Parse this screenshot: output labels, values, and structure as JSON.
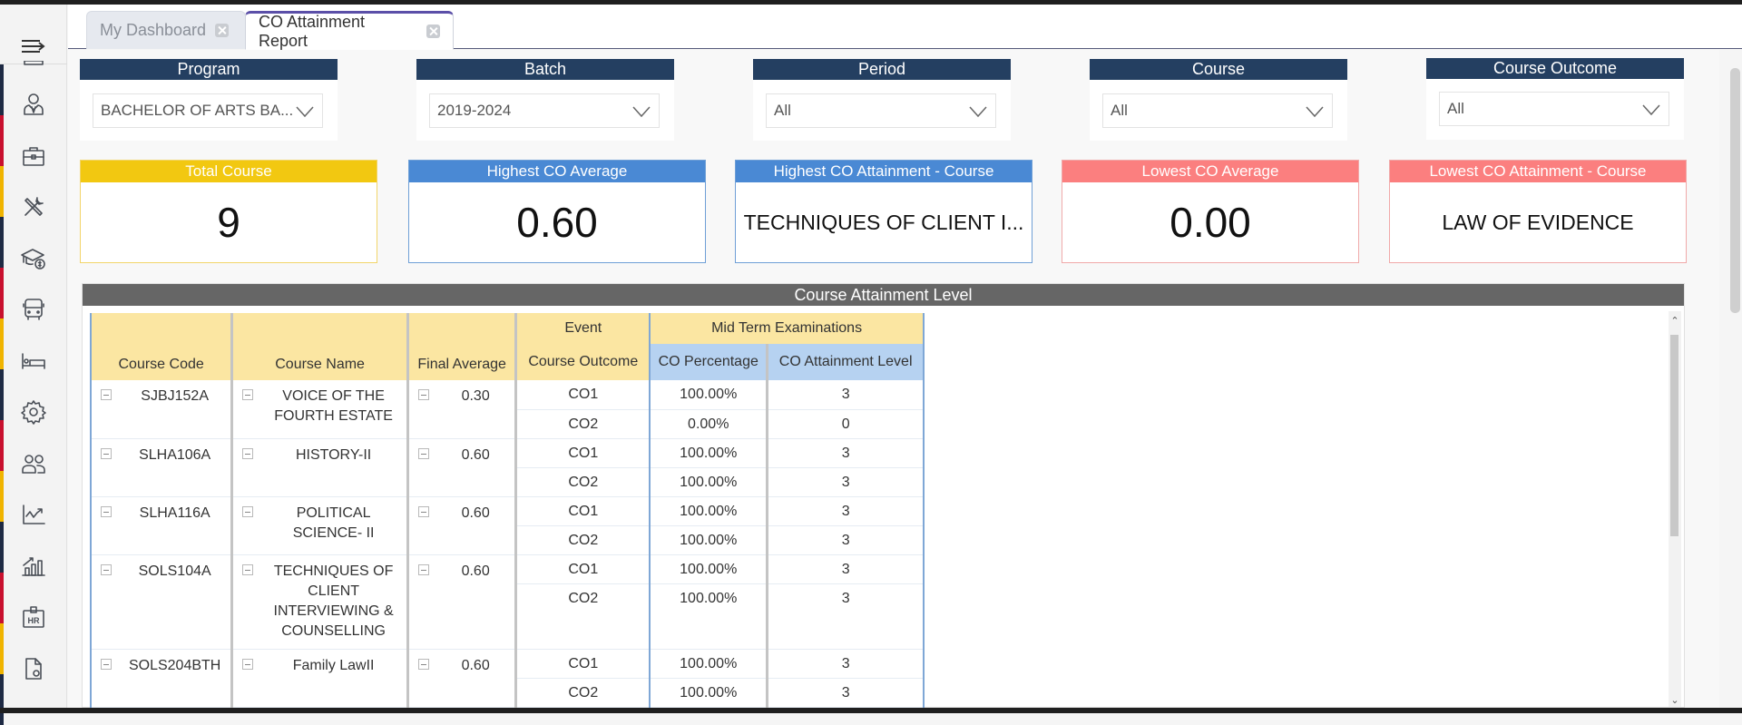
{
  "tabs": [
    {
      "label": "My Dashboard",
      "active": false
    },
    {
      "label": "CO Attainment Report",
      "active": true
    }
  ],
  "sidebar": {
    "stripe_colors": [
      "#1e2a44",
      "#c8102e",
      "#f0b400",
      "#1e2a44",
      "#c8102e",
      "#f0b400",
      "#1e2a44",
      "#c8102e",
      "#f0b400",
      "#1e2a44",
      "#c8102e",
      "#f0b400",
      "#1e2a44"
    ],
    "items": [
      {
        "icon": "partial-icon"
      },
      {
        "icon": "user-icon"
      },
      {
        "icon": "briefcase-icon"
      },
      {
        "icon": "tools-icon"
      },
      {
        "icon": "graduation-fee-icon"
      },
      {
        "icon": "bus-icon"
      },
      {
        "icon": "hostel-bed-icon"
      },
      {
        "icon": "gear-icon"
      },
      {
        "icon": "users-icon"
      },
      {
        "icon": "line-chart-icon"
      },
      {
        "icon": "bar-chart-icon"
      },
      {
        "icon": "hr-badge-icon"
      },
      {
        "icon": "document-settings-icon"
      }
    ]
  },
  "filters": [
    {
      "label": "Program",
      "value": "BACHELOR OF ARTS BA..."
    },
    {
      "label": "Batch",
      "value": "2019-2024"
    },
    {
      "label": "Period",
      "value": "All"
    },
    {
      "label": "Course",
      "value": "All"
    },
    {
      "label": "Course Outcome",
      "value": "All"
    }
  ],
  "kpis": [
    {
      "title": "Total Course",
      "value": "9",
      "color": "#f2c811",
      "border": "#f2d56a"
    },
    {
      "title": "Highest CO Average",
      "value": "0.60",
      "color": "#4a89d4",
      "border": "#6f9fd6"
    },
    {
      "title": "Highest CO Attainment - Course",
      "value": "TECHNIQUES OF  CLIENT I...",
      "color": "#4a89d4",
      "border": "#6f9fd6"
    },
    {
      "title": "Lowest CO Average",
      "value": "0.00",
      "color": "#fb7f7f",
      "border": "#f0a9a9"
    },
    {
      "title": "Lowest CO Attainment - Course",
      "value": "LAW OF EVIDENCE",
      "color": "#fb7f7f",
      "border": "#f0a9a9"
    }
  ],
  "report": {
    "title": "Course Attainment Level",
    "headers": {
      "course_code": "Course Code",
      "course_name": "Course Name",
      "final_average": "Final Average",
      "event": "Event",
      "event_name": "Mid Term Examinations",
      "course_outcome": "Course Outcome",
      "co_percentage": "CO Percentage",
      "co_attainment_level": "CO Attainment Level"
    },
    "rows": [
      {
        "code": "SJBJ152A",
        "name": "VOICE OF THE FOURTH ESTATE",
        "avg": "0.30",
        "outcomes": [
          {
            "co": "CO1",
            "pct": "100.00%",
            "level": "3"
          },
          {
            "co": "CO2",
            "pct": "0.00%",
            "level": "0"
          }
        ]
      },
      {
        "code": "SLHA106A",
        "name": "HISTORY-II",
        "avg": "0.60",
        "outcomes": [
          {
            "co": "CO1",
            "pct": "100.00%",
            "level": "3"
          },
          {
            "co": "CO2",
            "pct": "100.00%",
            "level": "3"
          }
        ]
      },
      {
        "code": "SLHA116A",
        "name": "POLITICAL SCIENCE- II",
        "avg": "0.60",
        "outcomes": [
          {
            "co": "CO1",
            "pct": "100.00%",
            "level": "3"
          },
          {
            "co": "CO2",
            "pct": "100.00%",
            "level": "3"
          }
        ]
      },
      {
        "code": "SOLS104A",
        "name": "TECHNIQUES OF CLIENT INTERVIEWING & COUNSELLING",
        "avg": "0.60",
        "outcomes": [
          {
            "co": "CO1",
            "pct": "100.00%",
            "level": "3"
          },
          {
            "co": "CO2",
            "pct": "100.00%",
            "level": "3"
          }
        ]
      },
      {
        "code": "SOLS204BTH",
        "name": "Family LawII",
        "avg": "0.60",
        "outcomes": [
          {
            "co": "CO1",
            "pct": "100.00%",
            "level": "3"
          },
          {
            "co": "CO2",
            "pct": "100.00%",
            "level": "3"
          }
        ]
      }
    ]
  }
}
